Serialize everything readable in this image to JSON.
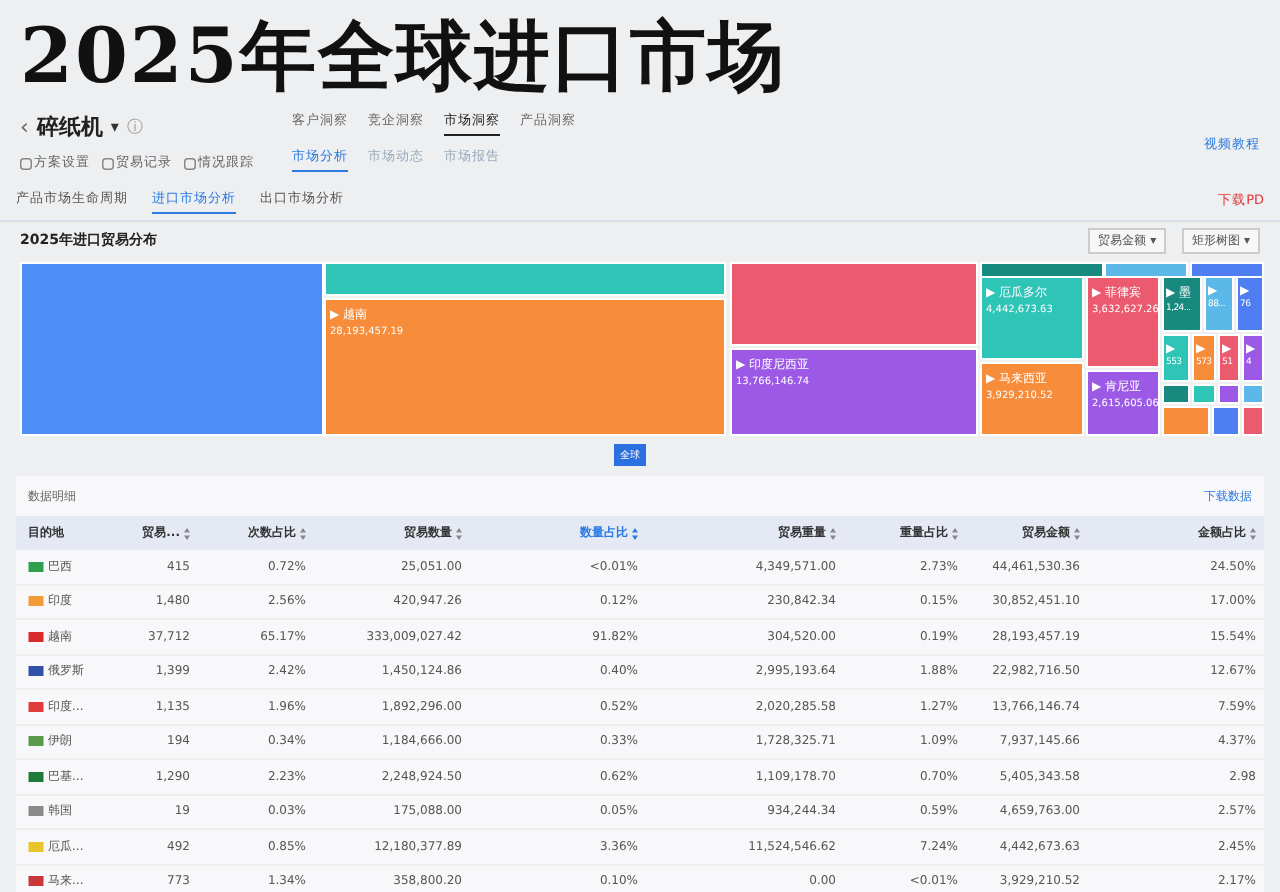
{
  "page_title": "2025年全球进口市场",
  "product": {
    "name": "碎纸机",
    "caret": "▾",
    "info": "ⓘ",
    "back": "‹"
  },
  "top_tabs": [
    {
      "label": "客户洞察",
      "selected": false
    },
    {
      "label": "竞企洞察",
      "selected": false
    },
    {
      "label": "市场洞察",
      "selected": true
    },
    {
      "label": "产品洞察",
      "selected": false
    }
  ],
  "tools": [
    "方案设置",
    "贸易记录",
    "情况跟踪"
  ],
  "sub_tabs": [
    {
      "label": "市场分析",
      "selected": true
    },
    {
      "label": "市场动态",
      "selected": false
    },
    {
      "label": "市场报告",
      "selected": false
    }
  ],
  "video_link": "视频教程",
  "analysis_tabs": [
    {
      "label": "产品市场生命周期",
      "selected": false
    },
    {
      "label": "进口市场分析",
      "selected": true
    },
    {
      "label": "出口市场分析",
      "selected": false
    }
  ],
  "download_pdf": "下载PD",
  "section_title": "2025年进口贸易分布",
  "selects": [
    "贸易金额 ▾",
    "矩形树图 ▾"
  ],
  "treemap": {
    "tiles": [
      {
        "color": "#4e8ef7"
      },
      {
        "color": "#2ec4b6"
      },
      {
        "color": "#f78c3a",
        "label": "▶ 越南",
        "value": "28,193,457.19"
      },
      {
        "color": "#eb5a6e"
      },
      {
        "color": "#9b59e6",
        "label": "▶ 印度尼西亚",
        "value": "13,766,146.74"
      },
      {
        "color": "#17897f"
      },
      {
        "color": "#5bb8e8"
      },
      {
        "color": "#4e7ef2"
      },
      {
        "color": "#2ec4b6",
        "label": "▶ 厄瓜多尔",
        "value": "4,442,673.63"
      },
      {
        "color": "#f78c3a",
        "label": "▶ 马来西亚",
        "value": "3,929,210.52"
      },
      {
        "color": "#eb5a6e",
        "label": "▶ 菲律宾",
        "value": "3,632,627.26"
      },
      {
        "color": "#9b59e6",
        "label": "▶ 肯尼亚",
        "value": "2,615,605.06"
      },
      {
        "color": "#17897f",
        "label": "▶ 墨",
        "value": "1,24..."
      },
      {
        "color": "#5bb8e8",
        "label": "▶",
        "value": "88..."
      },
      {
        "color": "#4e7ef2",
        "label": "▶",
        "value": "76"
      },
      {
        "color": "#2ec4b6",
        "label": "▶",
        "value": "553"
      },
      {
        "color": "#f78c3a",
        "label": "▶",
        "value": "573"
      },
      {
        "color": "#eb5a6e",
        "label": "▶",
        "value": "51"
      },
      {
        "color": "#9b59e6",
        "label": "▶",
        "value": "4"
      },
      {
        "color": "#17897f"
      },
      {
        "color": "#2ec4b6"
      },
      {
        "color": "#9b59e6"
      },
      {
        "color": "#5bb8e8"
      },
      {
        "color": "#f78c3a"
      },
      {
        "color": "#4e7ef2"
      },
      {
        "color": "#eb5a6e"
      }
    ]
  },
  "global_button": "全球",
  "table": {
    "title": "数据明细",
    "download": "下载数据",
    "columns": [
      {
        "label": "目的地",
        "sorted": false
      },
      {
        "label": "贸易...",
        "sorted": false
      },
      {
        "label": "次数占比",
        "sorted": false
      },
      {
        "label": "贸易数量",
        "sorted": false
      },
      {
        "label": "数量占比",
        "sorted": true
      },
      {
        "label": "贸易重量",
        "sorted": false
      },
      {
        "label": "重量占比",
        "sorted": false
      },
      {
        "label": "贸易金额",
        "sorted": false
      },
      {
        "label": "金额占比",
        "sorted": false
      }
    ],
    "rows": [
      {
        "color": "#2e9e4f",
        "cells": [
          "巴西",
          "415",
          "0.72%",
          "25,051.00",
          "<0.01%",
          "4,349,571.00",
          "2.73%",
          "44,461,530.36",
          "24.50%"
        ]
      },
      {
        "color": "#f29a36",
        "cells": [
          "印度",
          "1,480",
          "2.56%",
          "420,947.26",
          "0.12%",
          "230,842.34",
          "0.15%",
          "30,852,451.10",
          "17.00%"
        ]
      },
      {
        "color": "#d92b2b",
        "cells": [
          "越南",
          "37,712",
          "65.17%",
          "333,009,027.42",
          "91.82%",
          "304,520.00",
          "0.19%",
          "28,193,457.19",
          "15.54%"
        ]
      },
      {
        "color": "#2f4fa8",
        "cells": [
          "俄罗斯",
          "1,399",
          "2.42%",
          "1,450,124.86",
          "0.40%",
          "2,995,193.64",
          "1.88%",
          "22,982,716.50",
          "12.67%"
        ]
      },
      {
        "color": "#e03a3a",
        "cells": [
          "印度...",
          "1,135",
          "1.96%",
          "1,892,296.00",
          "0.52%",
          "2,020,285.58",
          "1.27%",
          "13,766,146.74",
          "7.59%"
        ]
      },
      {
        "color": "#5a9a4a",
        "cells": [
          "伊朗",
          "194",
          "0.34%",
          "1,184,666.00",
          "0.33%",
          "1,728,325.71",
          "1.09%",
          "7,937,145.66",
          "4.37%"
        ]
      },
      {
        "color": "#1e7a3a",
        "cells": [
          "巴基...",
          "1,290",
          "2.23%",
          "2,248,924.50",
          "0.62%",
          "1,109,178.70",
          "0.70%",
          "5,405,343.58",
          "2.98"
        ]
      },
      {
        "color": "#8a8a8a",
        "cells": [
          "韩国",
          "19",
          "0.03%",
          "175,088.00",
          "0.05%",
          "934,244.34",
          "0.59%",
          "4,659,763.00",
          "2.57%"
        ]
      },
      {
        "color": "#e8c32a",
        "cells": [
          "厄瓜...",
          "492",
          "0.85%",
          "12,180,377.89",
          "3.36%",
          "11,524,546.62",
          "7.24%",
          "4,442,673.63",
          "2.45%"
        ]
      },
      {
        "color": "#c8363a",
        "cells": [
          "马来...",
          "773",
          "1.34%",
          "358,800.20",
          "0.10%",
          "0.00",
          "<0.01%",
          "3,929,210.52",
          "2.17%"
        ]
      }
    ]
  }
}
